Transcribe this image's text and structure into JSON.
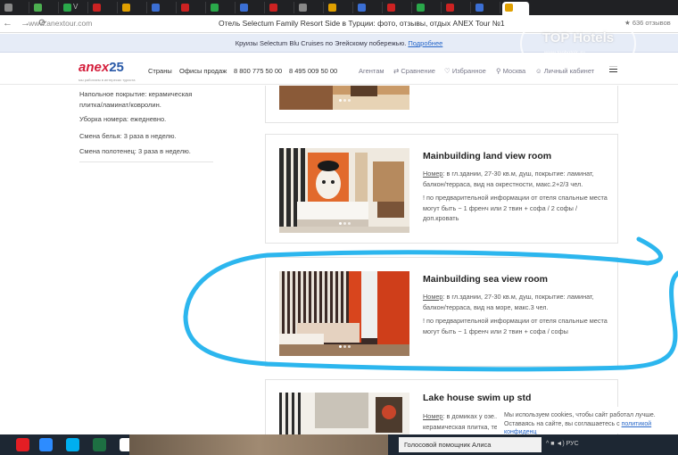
{
  "browser": {
    "tabs": [
      {
        "label": "",
        "color": "#888"
      },
      {
        "label": "",
        "color": "#4caf50"
      },
      {
        "label": "V",
        "color": "#2aa84a"
      },
      {
        "label": "",
        "color": "#cc2222"
      },
      {
        "label": "",
        "color": "#e0a000"
      },
      {
        "label": "",
        "color": "#3b6fd4"
      },
      {
        "label": "",
        "color": "#cc2222"
      },
      {
        "label": "",
        "color": "#2aa84a"
      },
      {
        "label": "",
        "color": "#3b6fd4"
      },
      {
        "label": "",
        "color": "#cc2222"
      },
      {
        "label": "",
        "color": "#888"
      },
      {
        "label": "",
        "color": "#e0a000"
      },
      {
        "label": "",
        "color": "#3b6fd4"
      },
      {
        "label": "",
        "color": "#cc2222"
      },
      {
        "label": "",
        "color": "#2aa84a"
      },
      {
        "label": "",
        "color": "#cc2222"
      },
      {
        "label": "",
        "color": "#3b6fd4"
      },
      {
        "label": "",
        "color": "#e0a000"
      }
    ],
    "nav_glyphs": "← → ⟳",
    "url": "www.anextour.com",
    "page_title": "Отель Selectum Family Resort Side в Турции: фото, отзывы, отдых ANEX Tour №1",
    "reviews_count": "636 отзывов"
  },
  "promo": {
    "text": "Круизы Selectum Blu Cruises по Эгейскому побережью.",
    "link": "Подробнее"
  },
  "header": {
    "logo_word": "anex",
    "logo_number": "25",
    "logo_tagline": "мы работаем в интересах туриста",
    "nav": [
      "Страны",
      "Офисы продаж",
      "8 800 775 50 00",
      "8 495 009 50 00"
    ],
    "agents": "Агентам",
    "compare": "Сравнение",
    "favorites": "Избранное",
    "city": "Москва",
    "cabinet": "Личный кабинет"
  },
  "watermark": {
    "text": "TOP Hotels",
    "sub": "www.tophotels.ru"
  },
  "sidebar": {
    "floor": "Напольное покрытие: керамическая плитка/ламинат/ковролин.",
    "cleaning": "Уборка номера: ежедневно.",
    "linen": "Смена белья: 3 раза в неделю.",
    "towels": "Смена полотенец: 3 раза в неделю."
  },
  "rooms": [
    {
      "title": "Mainbuilding land view room",
      "label": "Номер",
      "desc": ": в гл.здании, 27-30 кв.м, душ, покрытие: ламинат, балкон/терраса, вид на окрестности, макс.2+2/3 чел.",
      "note": "! по предварительной информации от отеля спальные места могут быть − 1 френч или 2 твин + софа / 2 софы / доп.кровать"
    },
    {
      "title": "Mainbuilding sea view room",
      "label": "Номер",
      "desc": ": в гл.здании, 27-30 кв.м, душ, покрытие: ламинат, балкон/терраса, вид на море, макс.3 чел.",
      "note": "! по предварительной информации от отеля спальные места могут быть − 1 френч или 2 твин + софа / софы"
    },
    {
      "title": "Lake house swim up std",
      "label": "Номер",
      "desc": ": в домиках у озе... односпальные кровати... и керамическая плитка, терраса, выход к общему"
    }
  ],
  "cookie": {
    "line1": "Мы используем cookies, чтобы сайт работал лучше.",
    "line2": "Оставаясь на сайте, вы соглашаетесь с",
    "link": "политикой конфиденц"
  },
  "taskbar": {
    "search": "Голосовой помощник Алиса",
    "icons": [
      {
        "name": "yandex",
        "color": "#e31e24"
      },
      {
        "name": "zoom",
        "color": "#2d8cff"
      },
      {
        "name": "skype",
        "color": "#00aff0"
      },
      {
        "name": "excel",
        "color": "#1d6f42"
      },
      {
        "name": "yandex-browser",
        "color": "#ffffff"
      }
    ],
    "tray": "^ ■ ◄) РУС"
  },
  "colors": {
    "accent_red": "#d41e3b",
    "accent_blue": "#2767c9",
    "scribble_blue": "#2cb6ee"
  }
}
